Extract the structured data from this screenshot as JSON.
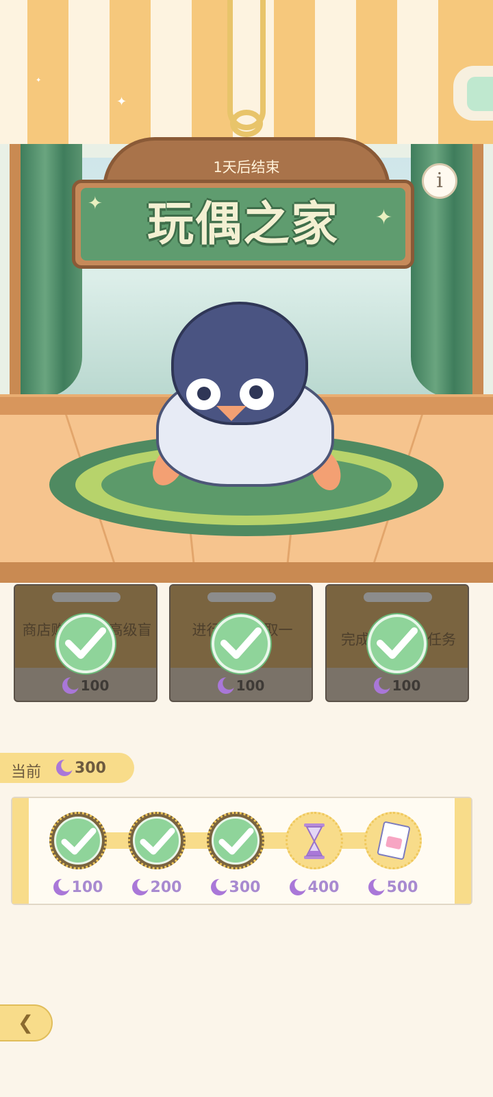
{
  "banner": {
    "end_text": "1天后结束",
    "title": "玩偶之家"
  },
  "tasks": [
    {
      "label": "商店购买一张高级盲盒兑换券",
      "reward": "100",
      "completed": true
    },
    {
      "label": "进行一次领取一",
      "reward": "100",
      "completed": true
    },
    {
      "label": "完成一个每日任务",
      "reward": "100",
      "completed": true
    }
  ],
  "current": {
    "label": "当前",
    "value": "300"
  },
  "milestones": [
    {
      "amount": "100",
      "completed": true,
      "reward_icon": "check-icon"
    },
    {
      "amount": "200",
      "completed": true,
      "reward_icon": "check-icon"
    },
    {
      "amount": "300",
      "completed": true,
      "reward_icon": "check-icon"
    },
    {
      "amount": "400",
      "completed": false,
      "reward_icon": "hourglass-icon"
    },
    {
      "amount": "500",
      "completed": false,
      "reward_icon": "ticket-icon"
    }
  ],
  "icons": {
    "currency": "moon-icon",
    "info": "info-icon",
    "back": "back-arrow-icon"
  },
  "colors": {
    "accent_yellow": "#f8dc8a",
    "check_green": "#8fd49a",
    "moon_purple": "#a977d8",
    "sign_green": "#5f9c6f"
  }
}
